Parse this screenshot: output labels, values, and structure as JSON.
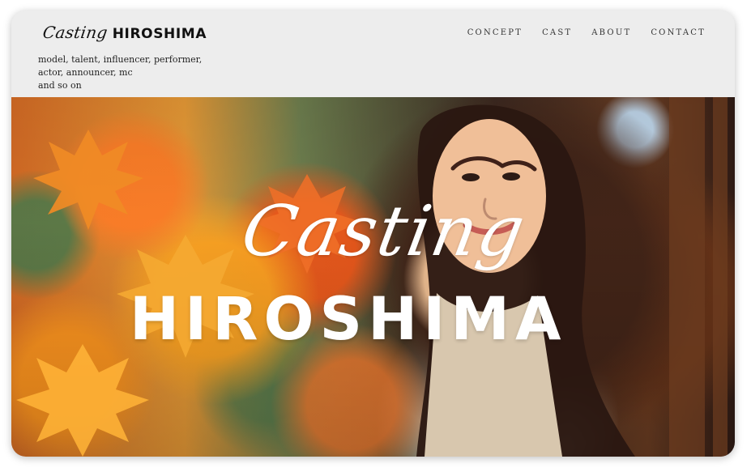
{
  "site": {
    "brand_script": "Casting",
    "brand_bold": "HIROSHIMA",
    "tagline_lines": [
      "model, talent, influencer, performer,",
      "actor, announcer, mc",
      "and so on"
    ]
  },
  "nav": {
    "items": [
      "CONCEPT",
      "CAST",
      "ABOUT",
      "CONTACT"
    ]
  },
  "hero": {
    "script_title": "Casting",
    "main_title": "HIROSHIMA"
  },
  "colors": {
    "header_bg": "#ededed",
    "text": "#111111",
    "hero_text": "#ffffff",
    "autumn_orange": "#e7862c",
    "autumn_gold": "#f3ab2f",
    "foliage_green": "#5f7d4f"
  }
}
